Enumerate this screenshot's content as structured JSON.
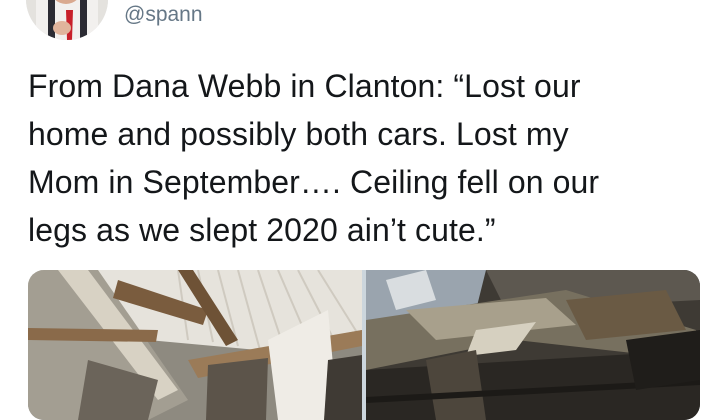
{
  "tweet": {
    "handle": "@spann",
    "text_lines": [
      "From Dana Webb in Clanton: “Lost our",
      "home and possibly both cars. Lost my",
      "Mom in September…. Ceiling fell on our",
      "legs as we slept 2020 ain’t cute.”"
    ]
  },
  "media": {
    "count": 2,
    "photos": [
      "collapsed-ceiling-photo",
      "debris-photo"
    ]
  },
  "icons": {
    "avatar": "profile-photo"
  }
}
